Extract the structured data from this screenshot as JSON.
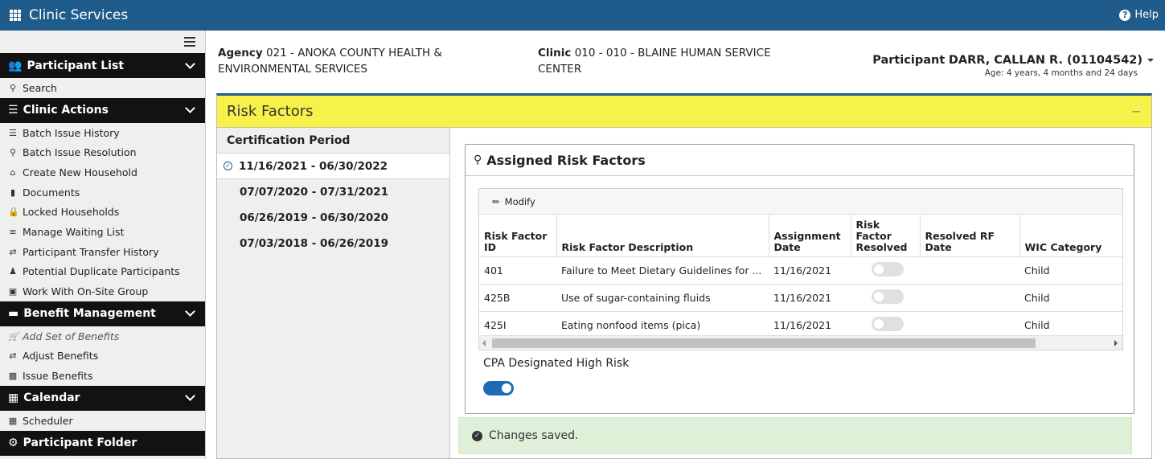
{
  "app": {
    "title": "Clinic Services",
    "help_label": "Help"
  },
  "sidebar": {
    "sections": [
      {
        "label": "Participant List",
        "icon": "users-icon",
        "items": [
          {
            "label": "Search",
            "icon": "search-icon"
          }
        ]
      },
      {
        "label": "Clinic Actions",
        "icon": "checklist-icon",
        "items": [
          {
            "label": "Batch Issue History",
            "icon": "list-icon"
          },
          {
            "label": "Batch Issue Resolution",
            "icon": "search-plus-icon"
          },
          {
            "label": "Create New Household",
            "icon": "home-icon"
          },
          {
            "label": "Documents",
            "icon": "file-icon"
          },
          {
            "label": "Locked Households",
            "icon": "lock-icon"
          },
          {
            "label": "Manage Waiting List",
            "icon": "list-ol-icon"
          },
          {
            "label": "Participant Transfer History",
            "icon": "exchange-icon"
          },
          {
            "label": "Potential Duplicate Participants",
            "icon": "user-check-icon"
          },
          {
            "label": "Work With On-Site Group",
            "icon": "group-icon"
          }
        ]
      },
      {
        "label": "Benefit Management",
        "icon": "credit-card-icon",
        "items": [
          {
            "label": "Add Set of Benefits",
            "icon": "cart-icon",
            "italic": true
          },
          {
            "label": "Adjust Benefits",
            "icon": "exchange-icon"
          },
          {
            "label": "Issue Benefits",
            "icon": "card-icon"
          }
        ]
      },
      {
        "label": "Calendar",
        "icon": "calendar-icon",
        "items": [
          {
            "label": "Scheduler",
            "icon": "calendar-small-icon"
          }
        ]
      },
      {
        "label": "Participant Folder",
        "icon": "gear-icon",
        "items": []
      }
    ]
  },
  "header": {
    "agency_label": "Agency",
    "agency_value": "021 - ANOKA COUNTY HEALTH &",
    "agency_value_2": "ENVIRONMENTAL SERVICES",
    "clinic_label": "Clinic",
    "clinic_value": "010 - 010 - BLAINE HUMAN SERVICE",
    "clinic_value_2": "CENTER",
    "participant_label": "Participant",
    "participant_name": "DARR, CALLAN R. (01104542)",
    "participant_age": "Age: 4 years, 4 months and 24 days"
  },
  "panel": {
    "title": "Risk Factors",
    "collapse_symbol": "−",
    "cert_title": "Certification Period",
    "periods": [
      "11/16/2021 - 06/30/2022",
      "07/07/2020 - 07/31/2021",
      "06/26/2019 - 06/30/2020",
      "07/03/2018 - 06/26/2019"
    ],
    "assigned_title": "Assigned Risk Factors",
    "modify_label": "Modify",
    "columns": [
      "Risk Factor ID",
      "Risk Factor Description",
      "Assignment Date",
      "Risk Factor Resolved",
      "Resolved RF Date",
      "WIC Category"
    ],
    "rows": [
      {
        "id": "401",
        "desc": "Failure to Meet Dietary Guidelines for ...",
        "date": "11/16/2021",
        "resolved": false,
        "resolved_date": "",
        "category": "Child"
      },
      {
        "id": "425B",
        "desc": "Use of sugar-containing fluids",
        "date": "11/16/2021",
        "resolved": false,
        "resolved_date": "",
        "category": "Child"
      },
      {
        "id": "425I",
        "desc": "Eating nonfood items (pica)",
        "date": "11/16/2021",
        "resolved": false,
        "resolved_date": "",
        "category": "Child"
      }
    ],
    "cpa_label": "CPA Designated High Risk",
    "cpa_on": true,
    "saved_message": "Changes saved."
  },
  "colors": {
    "topbar": "#1f5c8b",
    "panel_head": "#f6f24a",
    "toggle_on": "#1d6bb5",
    "success_bg": "#dff0d8"
  }
}
